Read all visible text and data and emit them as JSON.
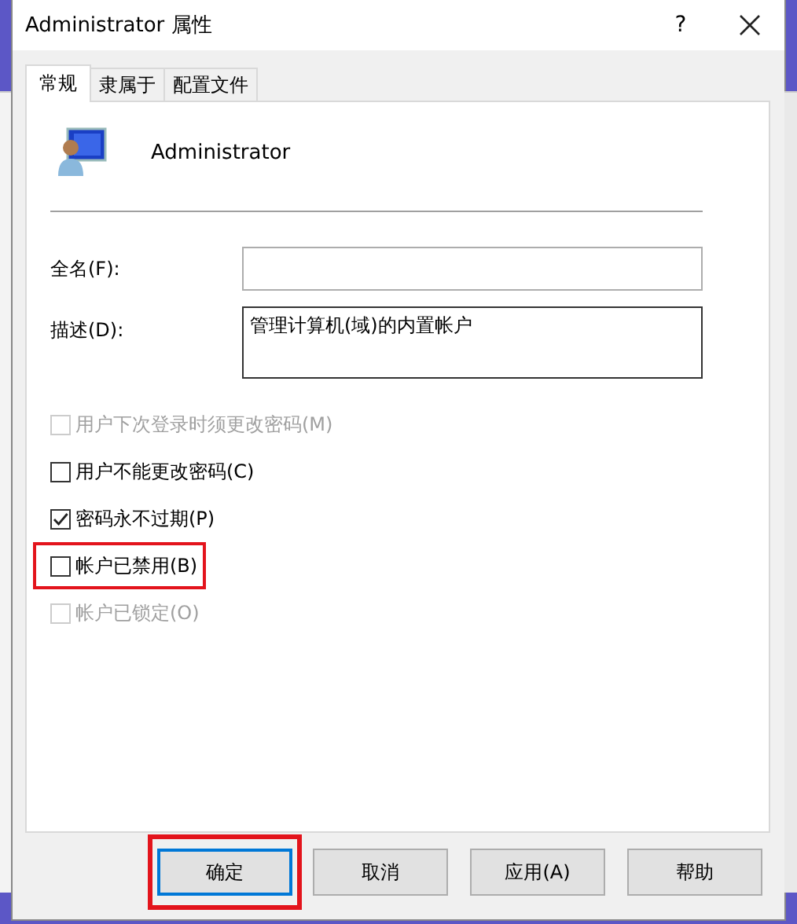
{
  "window": {
    "title": "Administrator 属性",
    "help": "?"
  },
  "tabs": [
    {
      "label": "常规",
      "selected": true
    },
    {
      "label": "隶属于",
      "selected": false
    },
    {
      "label": "配置文件",
      "selected": false
    }
  ],
  "user_name": "Administrator",
  "fields": [
    {
      "label": "全名(F):",
      "kind": "line"
    },
    {
      "label": "描述(D):",
      "value": "管理计算机(域)的内置帐户",
      "kind": "area"
    }
  ],
  "checkboxes": [
    {
      "label": "用户下次登录时须更改密码(M)",
      "checked": false,
      "disabled": true,
      "highlighted": false
    },
    {
      "label": "用户不能更改密码(C)",
      "checked": false,
      "disabled": false,
      "highlighted": false
    },
    {
      "label": "密码永不过期(P)",
      "checked": true,
      "disabled": false,
      "highlighted": false
    },
    {
      "label": "帐户已禁用(B)",
      "checked": false,
      "disabled": false,
      "highlighted": true
    },
    {
      "label": "帐户已锁定(O)",
      "checked": false,
      "disabled": true,
      "highlighted": false
    }
  ],
  "buttons": [
    {
      "label": "确定",
      "default": true,
      "highlighted": true
    },
    {
      "label": "取消",
      "default": false,
      "highlighted": false
    },
    {
      "label": "应用(A)",
      "default": false,
      "highlighted": false
    },
    {
      "label": "帮助",
      "default": false,
      "highlighted": false
    }
  ]
}
